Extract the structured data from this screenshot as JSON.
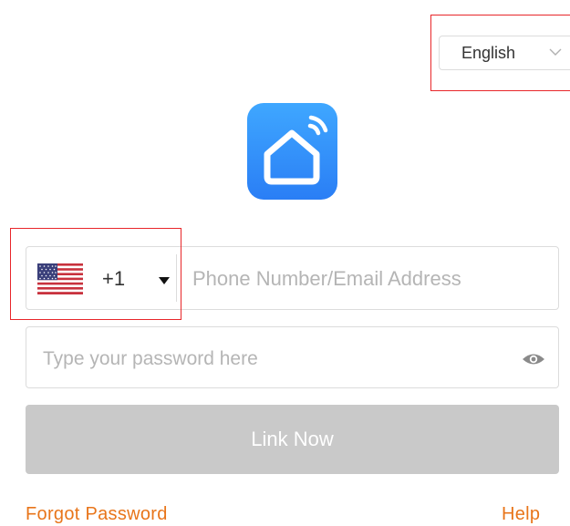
{
  "language": {
    "selected": "English",
    "icon": "chevron-down-icon"
  },
  "logo": {
    "icon": "smart-home-icon",
    "gradient_top": "#3fa7ff",
    "gradient_bottom": "#2a7ef5"
  },
  "login": {
    "country_code": "+1",
    "country_flag_icon": "us-flag-icon",
    "account_placeholder": "Phone Number/Email Address",
    "account_value": "",
    "password_placeholder": "Type your password here",
    "password_value": "",
    "password_toggle_icon": "eye-icon",
    "submit_label": "Link Now"
  },
  "links": {
    "forgot_password": "Forgot Password",
    "help": "Help"
  },
  "colors": {
    "highlight": "#e8262a",
    "link": "#e8751a",
    "button_disabled": "#c9c9c9"
  }
}
